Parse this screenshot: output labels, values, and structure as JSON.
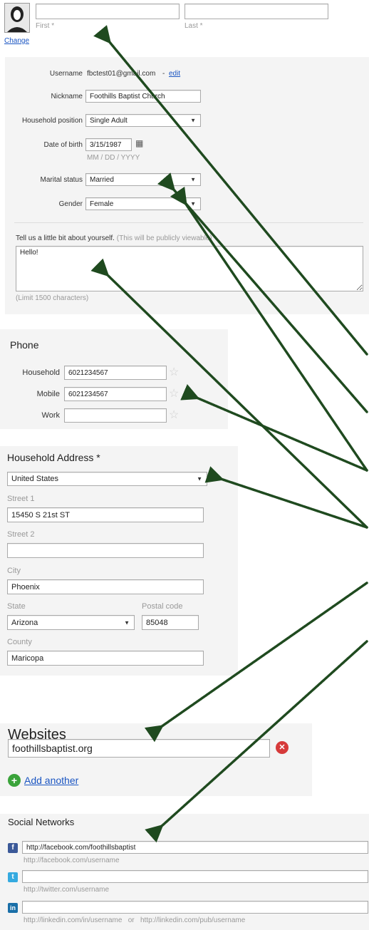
{
  "profile": {
    "change_link": "Change",
    "first_label": "First *",
    "last_label": "Last *",
    "first_value": "",
    "last_value": ""
  },
  "details": {
    "username_label": "Username",
    "username_value": "fbctest01@gmail.com",
    "username_sep": "-",
    "edit_link": "edit",
    "nickname_label": "Nickname",
    "nickname_value": "Foothills Baptist Church",
    "household_position_label": "Household position",
    "household_position_value": "Single Adult",
    "dob_label": "Date of birth",
    "dob_value": "3/15/1987",
    "dob_hint": "MM / DD / YYYY",
    "marital_label": "Marital status",
    "marital_value": "Married",
    "gender_label": "Gender",
    "gender_value": "Female",
    "about_label": "Tell us a little bit about yourself.",
    "about_note": "(This will be publicly viewable)",
    "about_value": "Hello!",
    "about_limit": "(Limit 1500 characters)"
  },
  "phone": {
    "title": "Phone",
    "rows": [
      {
        "label": "Household",
        "value": "6021234567"
      },
      {
        "label": "Mobile",
        "value": "6021234567"
      },
      {
        "label": "Work",
        "value": ""
      }
    ]
  },
  "address": {
    "title": "Household Address *",
    "country_value": "United States",
    "street1_label": "Street 1",
    "street1_value": "15450 S 21st ST",
    "street2_label": "Street 2",
    "street2_value": "",
    "city_label": "City",
    "city_value": "Phoenix",
    "state_label": "State",
    "state_value": "Arizona",
    "postal_label": "Postal code",
    "postal_value": "85048",
    "county_label": "County",
    "county_value": "Maricopa"
  },
  "websites": {
    "title": "Websites",
    "url_value": "foothillsbaptist.org",
    "add_another": "Add another"
  },
  "social": {
    "title": "Social Networks",
    "facebook_value": "http://facebook.com/foothillsbaptist",
    "facebook_hint": "http://facebook.com/username",
    "twitter_value": "",
    "twitter_hint": "http://twitter.com/username",
    "linkedin_value": "",
    "linkedin_hint": "http://linkedin.com/in/username   or   http://linkedin.com/pub/username"
  },
  "icons": {
    "facebook": "f",
    "twitter": "t",
    "linkedin": "in",
    "calendar": "▦",
    "remove": "✕",
    "add": "+",
    "star": "☆",
    "caret": "▼"
  },
  "colors": {
    "link": "#1a55c2",
    "arrow": "#1f4a1f",
    "remove": "#d63a3a",
    "add": "#3aa33a",
    "facebook": "#3b5998",
    "twitter": "#35aae0",
    "linkedin": "#1a6fa8"
  }
}
